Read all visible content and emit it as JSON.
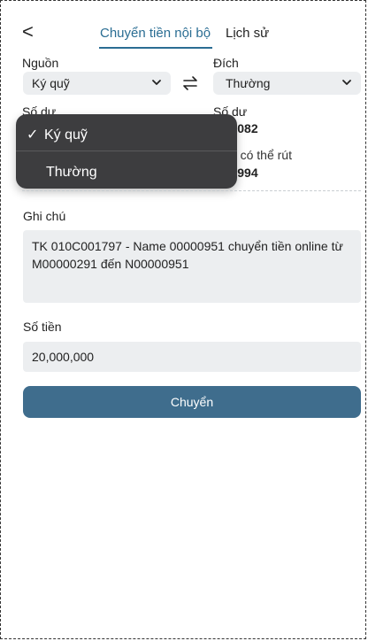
{
  "header": {
    "back_label": "<",
    "tabs": [
      {
        "label": "Chuyển tiền nội bộ",
        "active": true
      },
      {
        "label": "Lịch sử",
        "active": false
      }
    ]
  },
  "source": {
    "label": "Nguồn",
    "selected": "Ký quỹ",
    "balance_label": "Số dư"
  },
  "destination": {
    "label": "Đích",
    "selected": "Thường",
    "balance_label": "Số dư",
    "balance_value": "109,082",
    "withdrawable_label": "Tiền có thể rút",
    "withdrawable_value": "991,994"
  },
  "dropdown": {
    "options": [
      {
        "label": "Ký quỹ",
        "checked": true
      },
      {
        "label": "Thường",
        "checked": false
      }
    ]
  },
  "note": {
    "label": "Ghi chú",
    "value": "TK 010C001797 - Name 00000951 chuyển tiền online từ M00000291 đến N00000951"
  },
  "amount": {
    "label": "Số tiền",
    "value": "20,000,000"
  },
  "submit_label": "Chuyển",
  "colors": {
    "accent": "#2a6d93",
    "button": "#3f6d8d",
    "field_bg": "#eceef0",
    "menu_bg": "#3d3d3f"
  }
}
